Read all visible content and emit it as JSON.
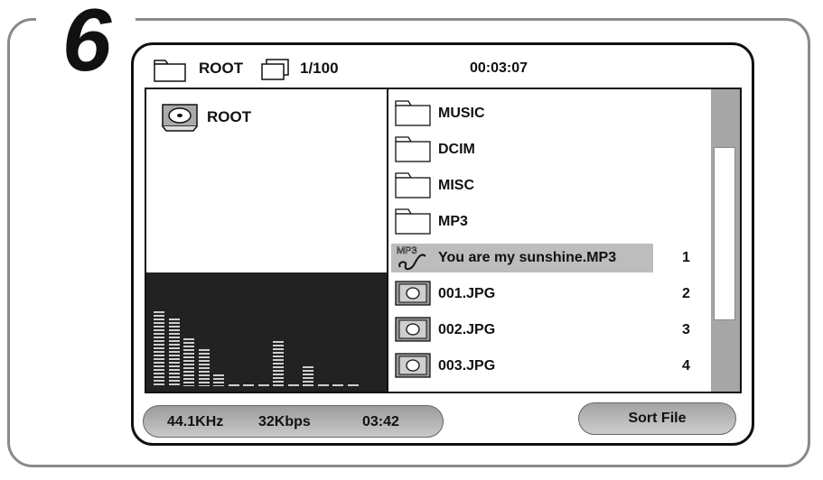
{
  "step": {
    "number": "6"
  },
  "topbar": {
    "root_label": "ROOT",
    "count": "1/100",
    "time": "00:03:07"
  },
  "tree": {
    "root_label": "ROOT"
  },
  "visualizer": {
    "levels": [
      0.75,
      0.68,
      0.48,
      0.37,
      0.12,
      0.02,
      0.02,
      0.02,
      0.45,
      0.02,
      0.2,
      0.02,
      0.02,
      0.02
    ]
  },
  "files": [
    {
      "name": "MUSIC",
      "icon": "folder-icon",
      "index": "",
      "selected": false
    },
    {
      "name": "DCIM",
      "icon": "folder-icon",
      "index": "",
      "selected": false
    },
    {
      "name": "MISC",
      "icon": "folder-icon",
      "index": "",
      "selected": false
    },
    {
      "name": "MP3",
      "icon": "folder-icon",
      "index": "",
      "selected": false
    },
    {
      "name": "You are my sunshine.MP3",
      "icon": "mp3-file-icon",
      "index": "1",
      "selected": true,
      "badge": "MP3"
    },
    {
      "name": "001.JPG",
      "icon": "image-file-icon",
      "index": "2",
      "selected": false
    },
    {
      "name": "002.JPG",
      "icon": "image-file-icon",
      "index": "3",
      "selected": false
    },
    {
      "name": "003.JPG",
      "icon": "image-file-icon",
      "index": "4",
      "selected": false
    }
  ],
  "status": {
    "sample_rate": "44.1KHz",
    "bitrate": "32Kbps",
    "duration": "03:42"
  },
  "buttons": {
    "sort": "Sort File"
  }
}
